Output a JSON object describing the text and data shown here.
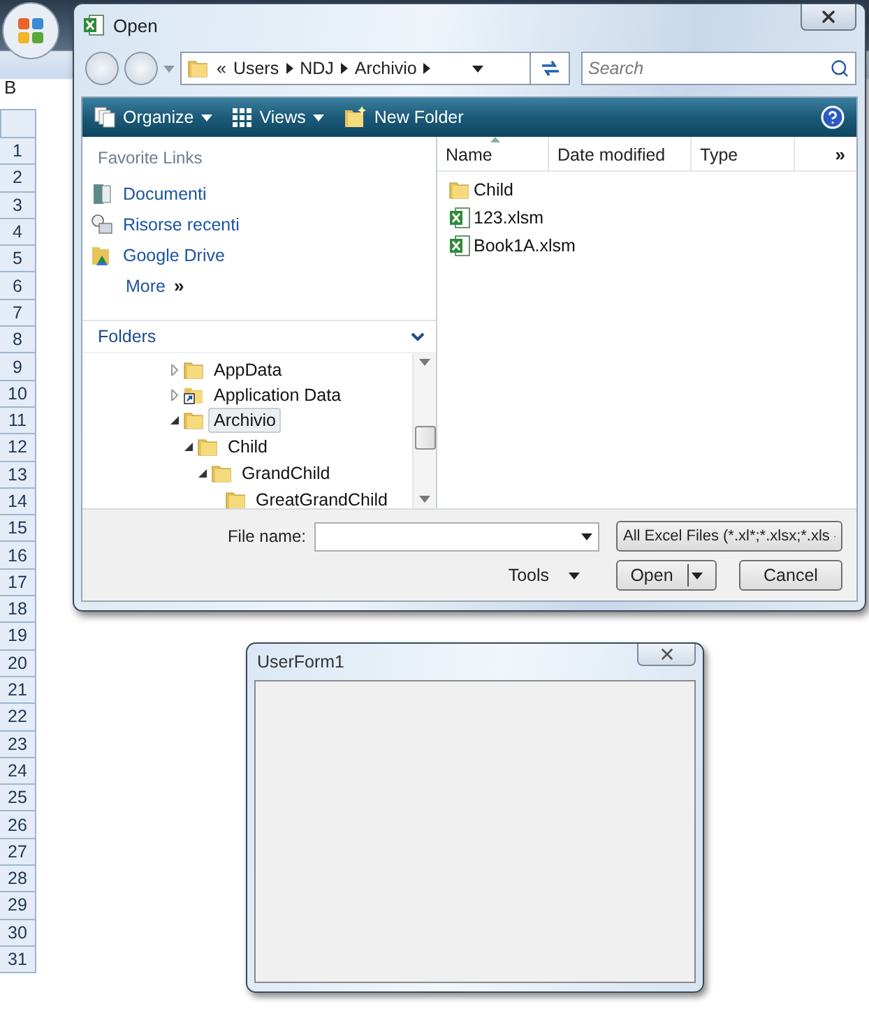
{
  "excel": {
    "ribbon_fragment": "B",
    "row_headers": [
      "1",
      "2",
      "3",
      "4",
      "5",
      "6",
      "7",
      "8",
      "9",
      "10",
      "11",
      "12",
      "13",
      "14",
      "15",
      "16",
      "17",
      "18",
      "19",
      "20",
      "21",
      "22",
      "23",
      "24",
      "25",
      "26",
      "27",
      "28",
      "29",
      "30",
      "31"
    ]
  },
  "open_dialog": {
    "title": "Open",
    "breadcrumb": {
      "overflow": "«",
      "parts": [
        "Users",
        "NDJ",
        "Archivio"
      ]
    },
    "search": {
      "placeholder": "Search"
    },
    "toolbar": [
      {
        "label": "Organize",
        "kind": "organize"
      },
      {
        "label": "Views",
        "kind": "views"
      },
      {
        "label": "New Folder",
        "kind": "new-folder"
      }
    ],
    "favorite_links": {
      "heading": "Favorite Links",
      "items": [
        {
          "label": "Documenti",
          "kind": "documents"
        },
        {
          "label": "Risorse recenti",
          "kind": "recent"
        },
        {
          "label": "Google Drive",
          "kind": "drive"
        }
      ],
      "more": {
        "label": "More",
        "chevron": "»"
      }
    },
    "folders": {
      "heading": "Folders",
      "tree": [
        {
          "label": "AppData",
          "kind": "folder",
          "expanded": false,
          "selected": false
        },
        {
          "label": "Application Data",
          "kind": "shortcut",
          "expanded": false,
          "selected": false
        },
        {
          "label": "Archivio",
          "kind": "folder",
          "expanded": true,
          "selected": true,
          "children": [
            {
              "label": "Child",
              "kind": "folder",
              "expanded": true,
              "selected": false,
              "children": [
                {
                  "label": "GrandChild",
                  "kind": "folder",
                  "expanded": true,
                  "selected": false,
                  "children": [
                    {
                      "label": "GreatGrandChild",
                      "kind": "folder",
                      "selected": false
                    }
                  ]
                }
              ]
            }
          ]
        }
      ]
    },
    "columns": [
      {
        "label": "Name",
        "sorted": true
      },
      {
        "label": "Date modified",
        "sorted": false
      },
      {
        "label": "Type",
        "sorted": false
      }
    ],
    "more_columns": "»",
    "files": [
      {
        "name": "Child",
        "kind": "folder"
      },
      {
        "name": "123.xlsm",
        "kind": "excel"
      },
      {
        "name": "Book1A.xlsm",
        "kind": "excel"
      }
    ],
    "file_name": {
      "label": "File name:"
    },
    "file_type": "All Excel Files (*.xl*;*.xlsx;*.xls",
    "tools": "Tools",
    "buttons": [
      {
        "label": "Open",
        "kind": "split"
      },
      {
        "label": "Cancel",
        "kind": "plain"
      }
    ]
  },
  "userform": {
    "title": "UserForm1"
  }
}
